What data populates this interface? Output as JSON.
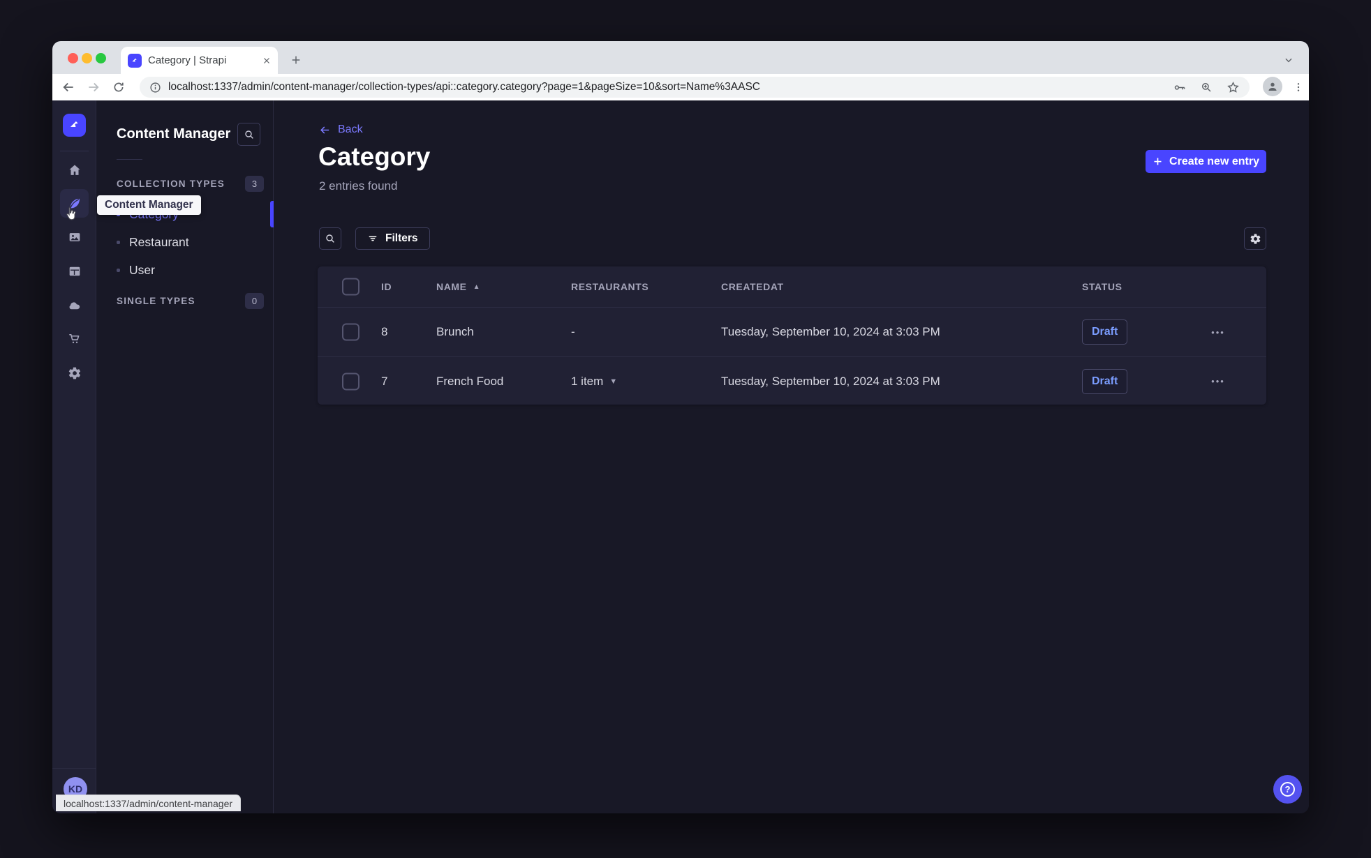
{
  "browser": {
    "tab_title": "Category | Strapi",
    "url": "localhost:1337/admin/content-manager/collection-types/api::category.category?page=1&pageSize=10&sort=Name%3AASC",
    "status_tooltip": "localhost:1337/admin/content-manager"
  },
  "sidebar": {
    "tooltip": "Content Manager",
    "avatar_initials": "KD",
    "items": [
      "home",
      "content-manager",
      "media-library",
      "content-type-builder",
      "deploy",
      "marketplace",
      "settings"
    ]
  },
  "subnav": {
    "title": "Content Manager",
    "sections": [
      {
        "label": "COLLECTION TYPES",
        "count": "3",
        "items": [
          {
            "label": "Category"
          },
          {
            "label": "Restaurant"
          },
          {
            "label": "User"
          }
        ]
      },
      {
        "label": "SINGLE TYPES",
        "count": "0",
        "items": []
      }
    ]
  },
  "main": {
    "back_label": "Back",
    "title": "Category",
    "subtitle": "2 entries found",
    "create_button": "Create new entry",
    "filters_button": "Filters",
    "table": {
      "columns": [
        "ID",
        "NAME",
        "RESTAURANTS",
        "CREATEDAT",
        "STATUS"
      ],
      "rows": [
        {
          "id": "8",
          "name": "Brunch",
          "restaurants": "-",
          "created_at": "Tuesday, September 10, 2024 at 3:03 PM",
          "status": "Draft"
        },
        {
          "id": "7",
          "name": "French Food",
          "restaurants": "1 item",
          "created_at": "Tuesday, September 10, 2024 at 3:03 PM",
          "status": "Draft"
        }
      ]
    }
  },
  "icons": {
    "more": "•••",
    "help": "?",
    "sort_asc": "▲",
    "chevron_down": "▼"
  },
  "colors": {
    "primary": "#4945ff",
    "accent_light": "#7b79ff",
    "background": "#181826",
    "surface": "#212134",
    "draft_text": "#7b9dff"
  }
}
